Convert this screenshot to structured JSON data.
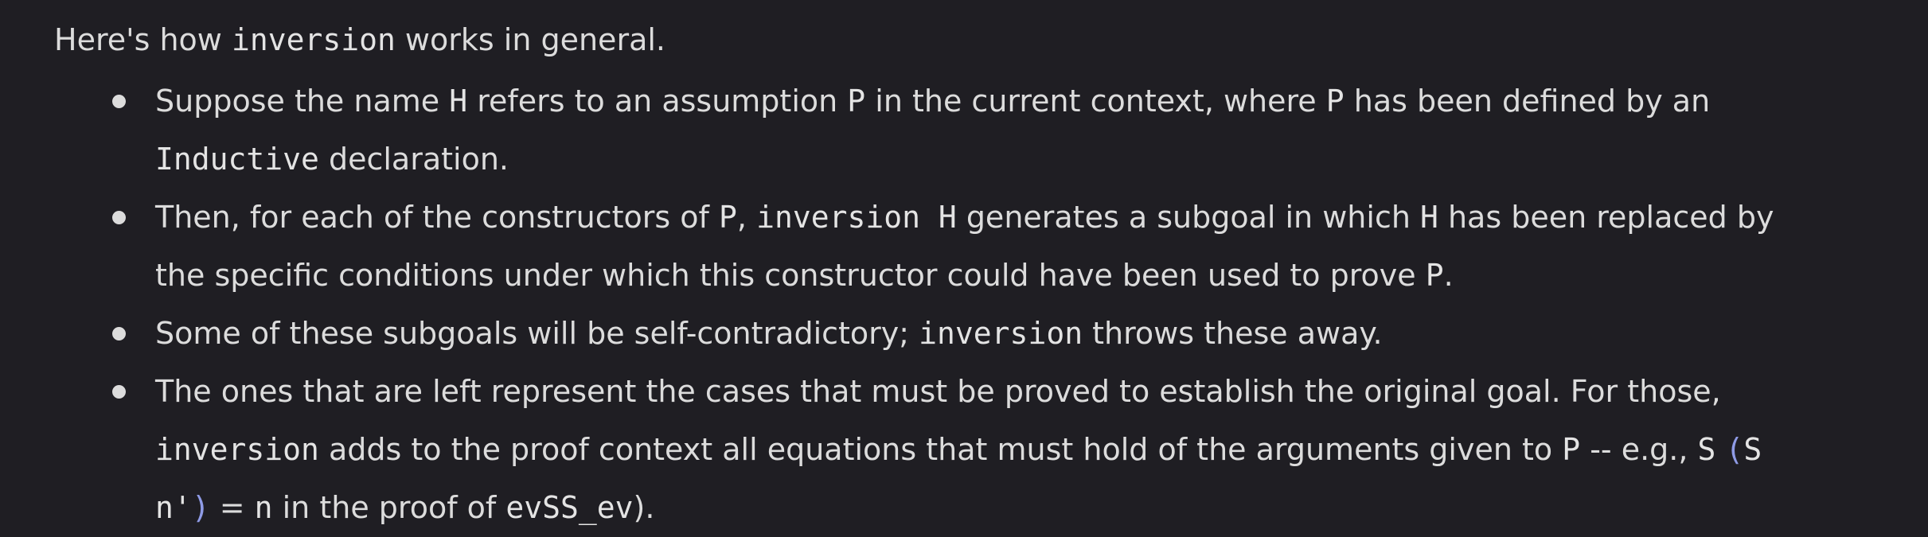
{
  "intro": {
    "pre": "Here's how ",
    "code": "inversion",
    "post": " works in general."
  },
  "bullets": [
    {
      "line1_a": "Suppose the name ",
      "line1_code1": "H",
      "line1_b": " refers to an assumption ",
      "line1_code2": "P",
      "line1_c": " in the current context, where ",
      "line1_code3": "P",
      "line1_d": " has been defined by an",
      "line2_code": "Inductive",
      "line2_a": " declaration."
    },
    {
      "line1_a": "Then, for each of the constructors of ",
      "line1_code1": "P",
      "line1_b": ", ",
      "line1_code2": "inversion H",
      "line1_c": " generates a subgoal in which ",
      "line1_code3": "H",
      "line1_d": " has been replaced by",
      "line2_a": "the specific conditions under which this constructor could have been used to prove ",
      "line2_code": "P",
      "line2_b": "."
    },
    {
      "line1_a": "Some of these subgoals will be self-contradictory; ",
      "line1_code1": "inversion",
      "line1_b": " throws these away."
    },
    {
      "line1_a": "The ones that are left represent the cases that must be proved to establish the original goal. For those,",
      "line2_code1": "inversion",
      "line2_a": " adds to the proof context all equations that must hold of the arguments given to ",
      "line2_code2": "P",
      "line2_b": " -- e.g., ",
      "line2_code3": "S",
      "line2_paren_open": "(",
      "line2_code4": "S",
      "line3_code1": "n'",
      "line3_paren_close": ")",
      "line3_a": " = ",
      "line3_code2": "n",
      "line3_b": " in the proof of ",
      "line3_code3": "evSS_ev",
      "line3_c": ")."
    }
  ]
}
